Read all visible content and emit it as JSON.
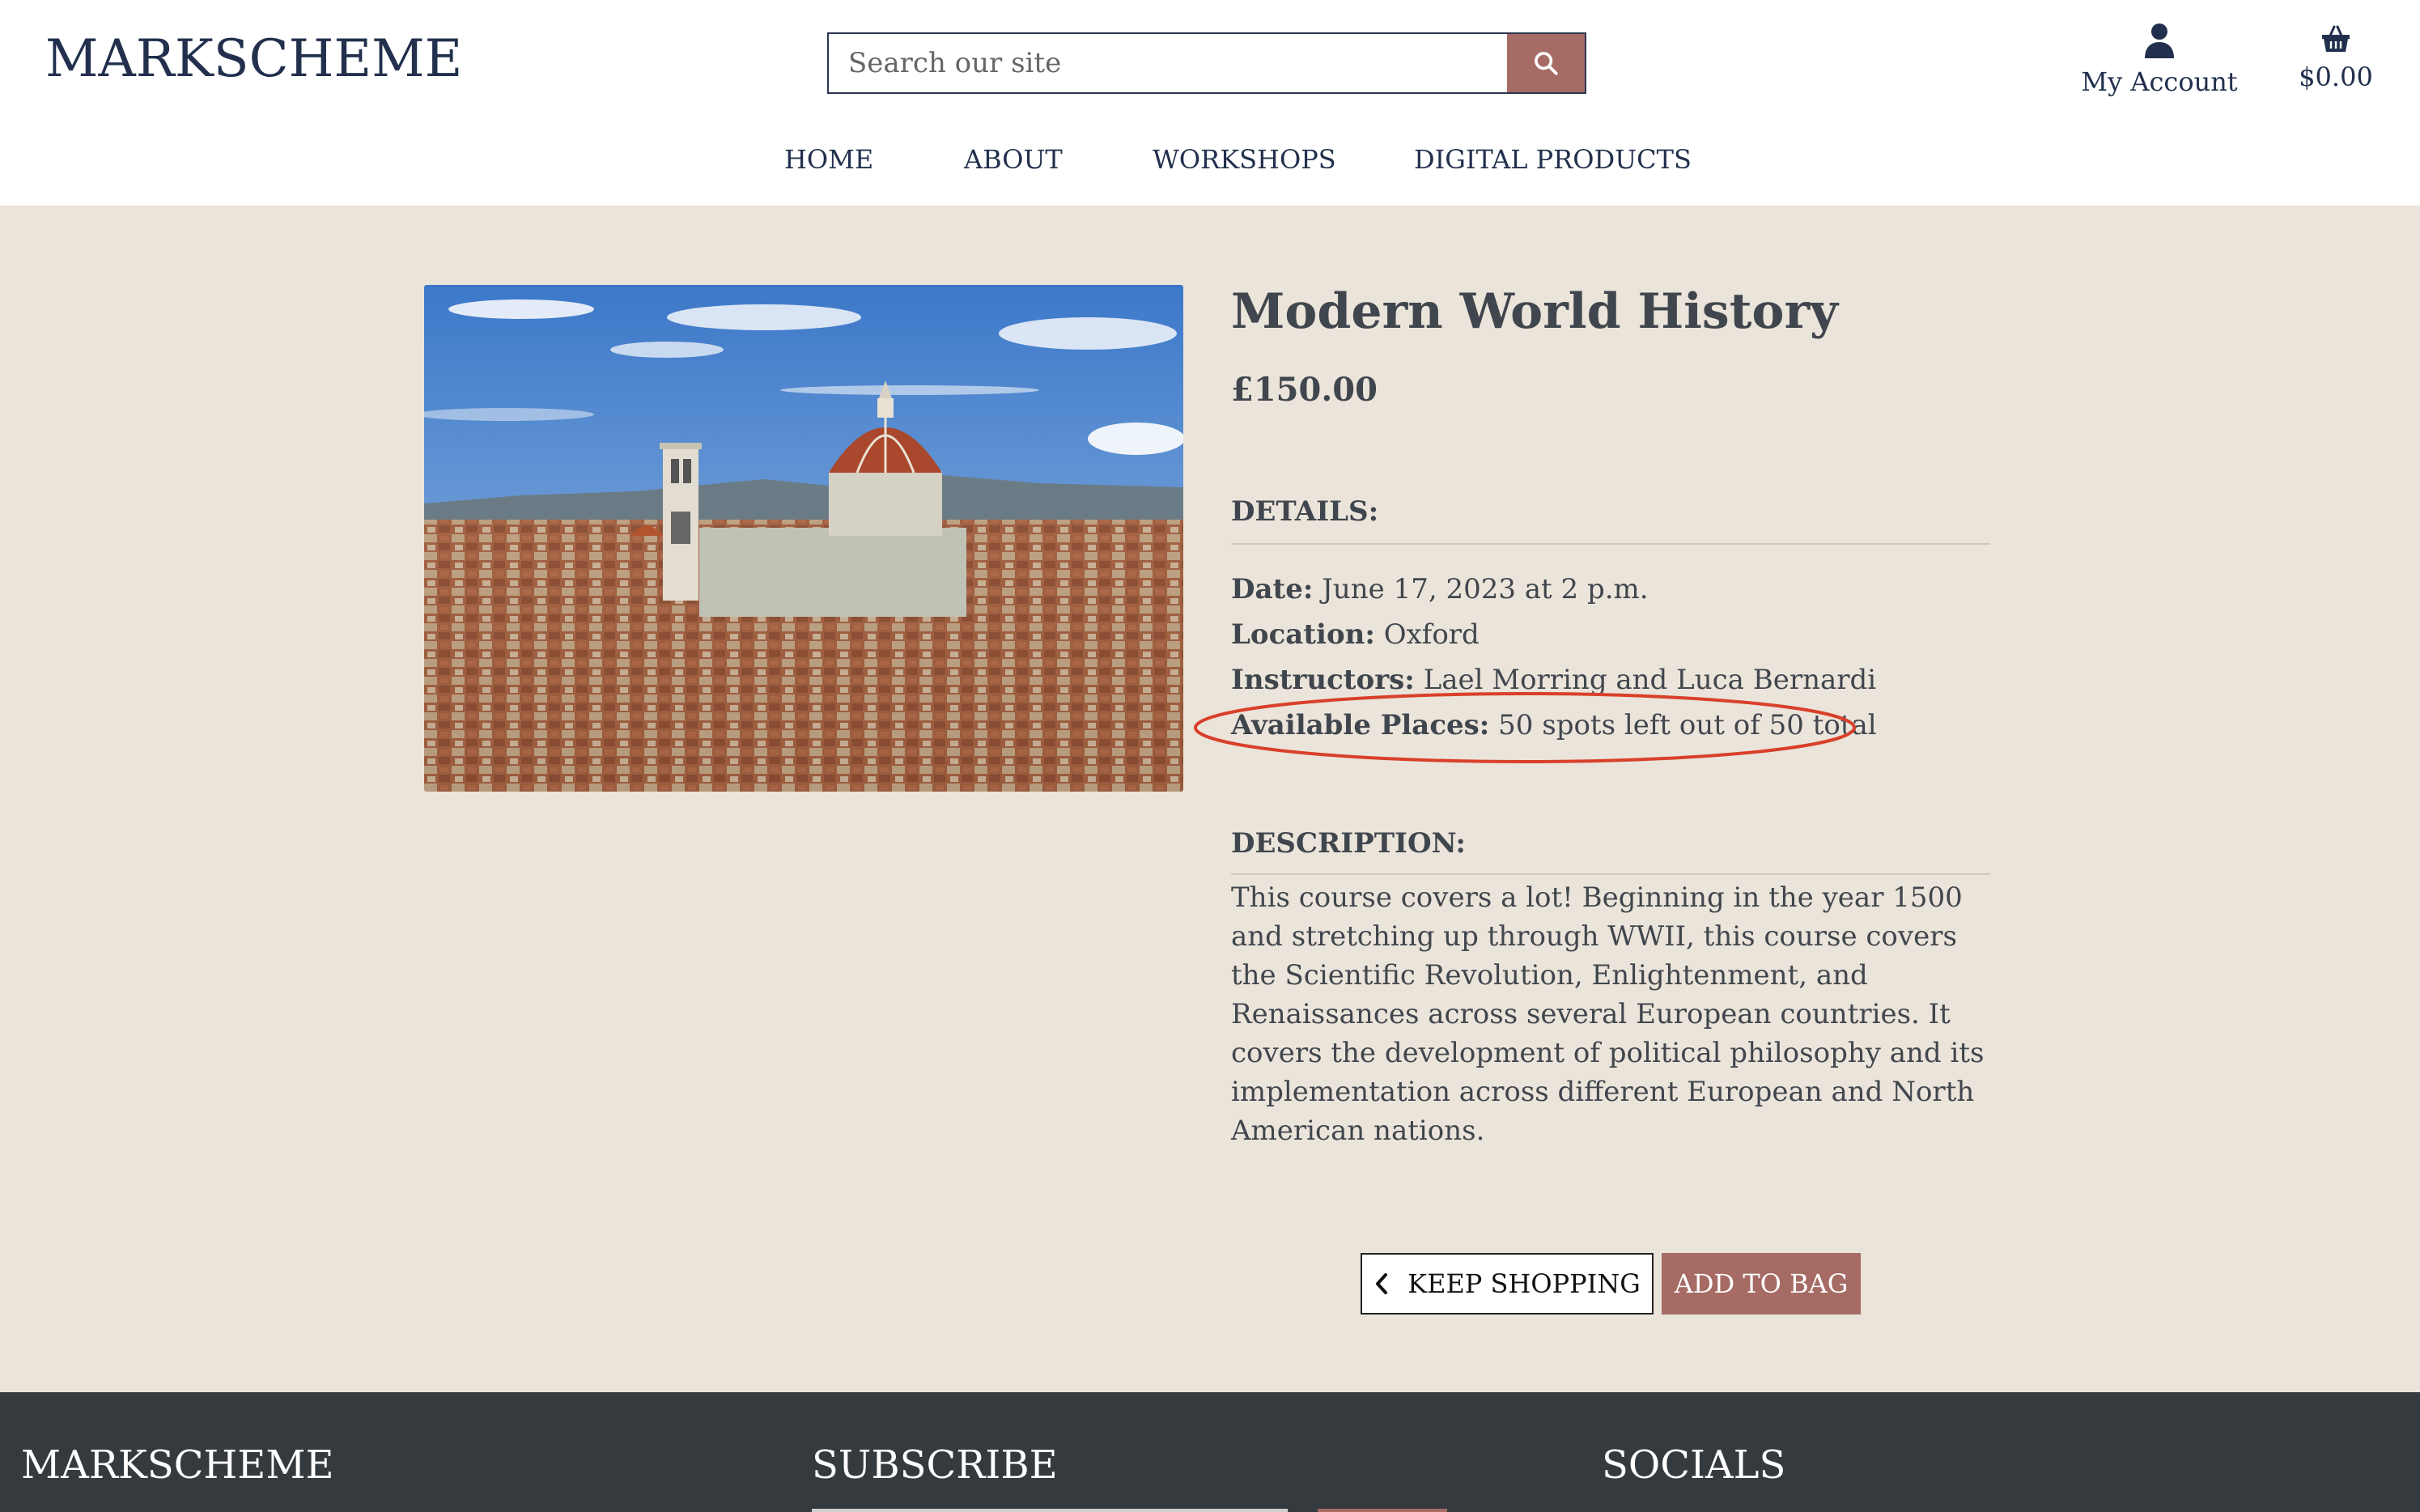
{
  "header": {
    "logo": "MARKSCHEME",
    "search": {
      "placeholder": "Search our site"
    },
    "account_label": "My Account",
    "bag_total": "$0.00"
  },
  "nav": {
    "items": [
      {
        "label": "HOME"
      },
      {
        "label": "ABOUT"
      },
      {
        "label": "WORKSHOPS"
      },
      {
        "label": "DIGITAL PRODUCTS"
      }
    ]
  },
  "product": {
    "title": "Modern World History",
    "price": "£150.00",
    "details_heading": "DETAILS:",
    "details": {
      "date_label": "Date:",
      "date_value": "June 17, 2023 at 2 p.m.",
      "location_label": "Location:",
      "location_value": "Oxford",
      "instructors_label": "Instructors:",
      "instructors_value": "Lael Morring and Luca Bernardi",
      "places_label": "Available Places:",
      "places_value": "50 spots left out of 50 total"
    },
    "description_heading": "DESCRIPTION:",
    "description": "This course covers a lot! Beginning in the year 1500 and stretching up through WWII, this course covers the Scientific Revolution, Enlightenment, and Renaissances across several European countries. It covers the development of political philosophy and its implementation across different European and North American nations."
  },
  "actions": {
    "keep_shopping": "KEEP SHOPPING",
    "add_to_bag": "ADD TO BAG"
  },
  "footer": {
    "brand": "MARKSCHEME",
    "subscribe": "SUBSCRIBE",
    "socials": "SOCIALS"
  },
  "colors": {
    "accent": "#a56b64",
    "navy": "#22304d",
    "page_bg": "#ebe4da",
    "footer_bg": "#353a3f",
    "annotation": "#d9402a"
  },
  "icons": [
    "search-icon",
    "user-icon",
    "basket-icon",
    "chevron-left-icon"
  ]
}
